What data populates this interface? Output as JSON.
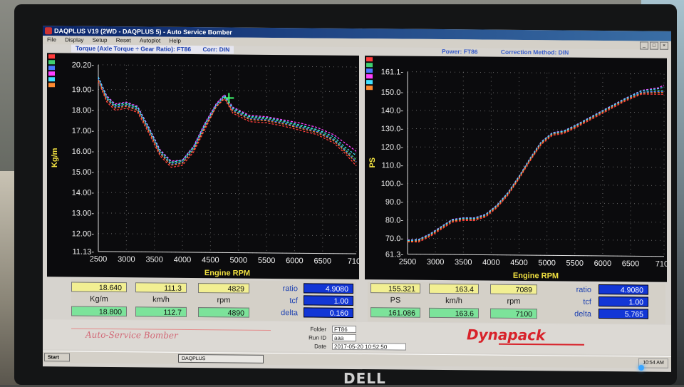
{
  "window": {
    "title": "DAQPLUS V19 (2WD - DAQPLUS 5) - Auto Service Bomber"
  },
  "menu": [
    "File",
    "Display",
    "Setup",
    "Reset",
    "Autoplot",
    "Help"
  ],
  "colors": {
    "plot_bg": "#0b0b0d",
    "grid": "#8a8a8a",
    "yellow_text": "#f0e040",
    "blue_title": "#1b3fb0",
    "series": [
      "#ff3b3b",
      "#40d070",
      "#4a78ff",
      "#ff40ff",
      "#40e0ff",
      "#ff8a30"
    ]
  },
  "torque_chart": {
    "title": "Torque (Axle Torque ÷ Gear Ratio): FT86",
    "corr": "Corr: DIN"
  },
  "power_chart": {
    "title": "Power: FT86",
    "corr": "Correction Method: DIN"
  },
  "chart_data": [
    {
      "type": "line",
      "title": "Torque (Axle Torque ÷ Gear Ratio): FT86",
      "xlabel": "Engine RPM",
      "ylabel": "Kg/m",
      "xlim": [
        2500,
        7100
      ],
      "ylim": [
        11.13,
        20.2
      ],
      "x_ticks": [
        "2500",
        "3000",
        "3500",
        "4000",
        "4500",
        "5000",
        "5500",
        "6000",
        "6500",
        "7100"
      ],
      "y_ticks": [
        "20.20",
        "19.00",
        "18.00",
        "17.00",
        "16.00",
        "15.00",
        "14.00",
        "13.00",
        "12.00",
        "11.13"
      ],
      "grid": true,
      "cursor": {
        "x": 4829,
        "y": 18.64
      },
      "x": [
        2500,
        2650,
        2800,
        3000,
        3200,
        3400,
        3600,
        3800,
        4000,
        4200,
        4400,
        4600,
        4750,
        4900,
        5200,
        5500,
        5800,
        6100,
        6400,
        6700,
        6900,
        7100
      ],
      "series": [
        {
          "values": [
            19.4,
            18.4,
            18.0,
            18.1,
            17.9,
            16.9,
            15.8,
            15.25,
            15.35,
            16.0,
            17.1,
            18.2,
            18.6,
            17.9,
            17.5,
            17.45,
            17.3,
            17.1,
            16.9,
            16.5,
            16.0,
            15.4
          ]
        },
        {
          "values": [
            19.5,
            18.6,
            18.2,
            18.3,
            18.1,
            17.1,
            16.0,
            15.45,
            15.55,
            16.2,
            17.3,
            18.3,
            18.75,
            18.1,
            17.7,
            17.65,
            17.5,
            17.3,
            17.1,
            16.7,
            16.2,
            15.7
          ]
        },
        {
          "values": [
            19.5,
            18.55,
            18.15,
            18.25,
            18.05,
            17.05,
            15.95,
            15.4,
            15.5,
            16.15,
            17.25,
            18.25,
            18.7,
            18.05,
            17.65,
            17.6,
            17.45,
            17.25,
            17.05,
            16.65,
            16.15,
            15.6
          ]
        },
        {
          "values": [
            19.6,
            18.7,
            18.3,
            18.4,
            18.2,
            17.2,
            16.1,
            15.55,
            15.6,
            16.3,
            17.4,
            18.35,
            18.8,
            18.2,
            17.8,
            17.75,
            17.6,
            17.45,
            17.25,
            16.9,
            16.5,
            16.1
          ]
        },
        {
          "values": [
            19.6,
            18.65,
            18.25,
            18.35,
            18.15,
            17.15,
            16.05,
            15.5,
            15.6,
            16.25,
            17.35,
            18.3,
            18.75,
            18.15,
            17.75,
            17.7,
            17.55,
            17.35,
            17.15,
            16.8,
            16.3,
            15.9
          ]
        },
        {
          "values": [
            19.45,
            18.5,
            18.1,
            18.2,
            18.0,
            17.0,
            15.9,
            15.35,
            15.45,
            16.1,
            17.2,
            18.2,
            18.65,
            18.0,
            17.6,
            17.55,
            17.4,
            17.2,
            17.0,
            16.6,
            16.1,
            15.55
          ]
        }
      ]
    },
    {
      "type": "line",
      "title": "Power: FT86",
      "xlabel": "Engine RPM",
      "ylabel": "PS",
      "xlim": [
        2500,
        7100
      ],
      "ylim": [
        61.3,
        161.1
      ],
      "x_ticks": [
        "2500",
        "3000",
        "3500",
        "4000",
        "4500",
        "5000",
        "5500",
        "6000",
        "6500",
        "7100"
      ],
      "y_ticks": [
        "161.1",
        "150.0",
        "140.0",
        "130.0",
        "120.0",
        "110.0",
        "100.0",
        "90.0",
        "80.0",
        "70.0",
        "61.3"
      ],
      "grid": true,
      "x": [
        2500,
        2700,
        2900,
        3100,
        3300,
        3500,
        3700,
        3900,
        4100,
        4300,
        4500,
        4700,
        4900,
        5100,
        5300,
        5500,
        5800,
        6100,
        6400,
        6700,
        7000,
        7100
      ],
      "series": [
        {
          "values": [
            68,
            68,
            71,
            75,
            79,
            80,
            80,
            82,
            87,
            94,
            103,
            113,
            122,
            127,
            128,
            131,
            136,
            141,
            146,
            150,
            150,
            150
          ]
        },
        {
          "values": [
            68.5,
            69,
            72,
            76,
            80,
            81,
            81,
            83,
            88,
            95,
            104,
            114,
            123,
            128,
            129,
            132,
            137,
            142,
            147,
            151,
            152,
            152
          ]
        },
        {
          "values": [
            68.3,
            68.8,
            71.8,
            75.8,
            79.8,
            80.8,
            80.8,
            82.8,
            87.8,
            94.8,
            103.8,
            113.8,
            122.8,
            127.8,
            128.8,
            131.8,
            136.8,
            141.8,
            146.8,
            151,
            151.5,
            151.5
          ]
        },
        {
          "values": [
            69,
            69.5,
            72.5,
            76.5,
            80.5,
            81.5,
            81.5,
            83.5,
            88.5,
            95.5,
            104.5,
            114.5,
            123.5,
            128.5,
            129.5,
            132.5,
            137.5,
            142.5,
            147.5,
            152,
            153.5,
            155
          ]
        },
        {
          "values": [
            68.8,
            69.3,
            72.3,
            76.3,
            80.3,
            81.3,
            81.3,
            83.3,
            88.3,
            95.3,
            104.3,
            114.3,
            123.3,
            128.3,
            129.3,
            132.3,
            137.3,
            142.3,
            147.3,
            151.8,
            153,
            154
          ]
        },
        {
          "values": [
            68.2,
            68.6,
            71.6,
            75.6,
            79.6,
            80.6,
            80.6,
            82.6,
            87.6,
            94.6,
            103.6,
            113.6,
            122.6,
            127.6,
            128.6,
            131.6,
            136.6,
            141.6,
            146.6,
            150.5,
            151,
            151
          ]
        }
      ]
    }
  ],
  "readout_left": {
    "row1": [
      "18.640",
      "111.3",
      "4829"
    ],
    "units": [
      "Kg/m",
      "km/h",
      "rpm"
    ],
    "row2": [
      "18.800",
      "112.7",
      "4890"
    ],
    "params": [
      "ratio",
      "tcf",
      "delta"
    ],
    "param_values": [
      "4.9080",
      "1.00",
      "0.160"
    ]
  },
  "readout_right": {
    "row1": [
      "155.321",
      "163.4",
      "7089"
    ],
    "units": [
      "PS",
      "km/h",
      "rpm"
    ],
    "row2": [
      "161.086",
      "163.6",
      "7100"
    ],
    "params": [
      "ratio",
      "tcf",
      "delta"
    ],
    "param_values": [
      "4.9080",
      "1.00",
      "5.765"
    ]
  },
  "footer": {
    "brand": "Auto-Service Bomber",
    "folder_label": "Folder",
    "folder_value": "FT86",
    "runid_label": "Run ID",
    "runid_value": "aaa",
    "date_label": "Date",
    "date_value": "2017-05-20 10:52:50",
    "logo": "Dynapack"
  },
  "taskbar": {
    "start": "Start",
    "task": "DAQPLUS",
    "clock": "10:54 AM"
  },
  "bezel_logo": "DELL"
}
